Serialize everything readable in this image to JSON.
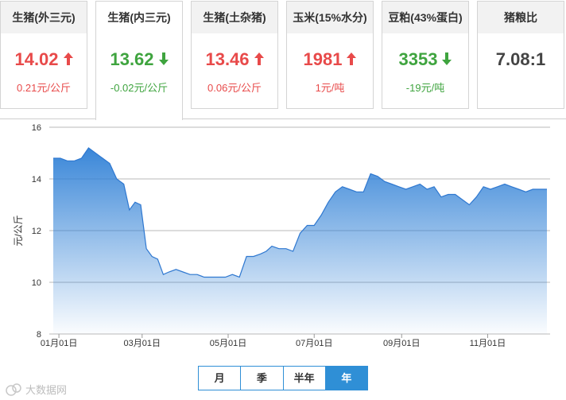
{
  "cards": [
    {
      "title": "生猪(外三元)",
      "price": "14.02",
      "change": "0.21元/公斤",
      "trend": "up"
    },
    {
      "title": "生猪(内三元)",
      "price": "13.62",
      "change": "-0.02元/公斤",
      "trend": "down"
    },
    {
      "title": "生猪(土杂猪)",
      "price": "13.46",
      "change": "0.06元/公斤",
      "trend": "up"
    },
    {
      "title": "玉米(15%水分)",
      "price": "1981",
      "change": "1元/吨",
      "trend": "up"
    },
    {
      "title": "豆粕(43%蛋白)",
      "price": "3353",
      "change": "-19元/吨",
      "trend": "down"
    },
    {
      "title": "猪粮比",
      "price": "7.08:1",
      "change": "",
      "trend": "none"
    }
  ],
  "range_buttons": [
    "月",
    "季",
    "半年",
    "年"
  ],
  "selected_range": "年",
  "watermark": "大数据网",
  "colors": {
    "up": "#e84a4a",
    "down": "#3fa43f",
    "accent": "#2f8fd6"
  },
  "chart_data": {
    "type": "area",
    "title": "",
    "xlabel": "",
    "ylabel": "元/公斤",
    "ylim": [
      8,
      16
    ],
    "yticks": [
      8,
      10,
      12,
      14,
      16
    ],
    "xticks": [
      "01月01日",
      "03月01日",
      "05月01日",
      "07月01日",
      "09月01日",
      "11月01日"
    ],
    "grid": true,
    "legend": "none",
    "x": [
      "12-28",
      "01-02",
      "01-07",
      "01-12",
      "01-17",
      "01-22",
      "01-27",
      "02-01",
      "02-06",
      "02-11",
      "02-16",
      "02-20",
      "02-24",
      "02-28",
      "03-04",
      "03-08",
      "03-12",
      "03-16",
      "03-20",
      "03-25",
      "03-30",
      "04-04",
      "04-09",
      "04-14",
      "04-19",
      "04-24",
      "04-29",
      "05-04",
      "05-09",
      "05-14",
      "05-19",
      "05-24",
      "05-28",
      "06-01",
      "06-06",
      "06-11",
      "06-16",
      "06-21",
      "06-26",
      "07-01",
      "07-06",
      "07-11",
      "07-16",
      "07-21",
      "07-26",
      "07-31",
      "08-05",
      "08-10",
      "08-15",
      "08-20",
      "08-25",
      "08-30",
      "09-04",
      "09-09",
      "09-14",
      "09-19",
      "09-24",
      "09-29",
      "10-04",
      "10-09",
      "10-14",
      "10-19",
      "10-24",
      "10-29",
      "11-03",
      "11-08",
      "11-13",
      "11-18",
      "11-23",
      "11-28",
      "12-03",
      "12-08",
      "12-13"
    ],
    "values": [
      14.8,
      14.8,
      14.7,
      14.7,
      14.8,
      15.2,
      15.0,
      14.8,
      14.6,
      14.0,
      13.8,
      12.8,
      13.1,
      13.0,
      11.3,
      11.0,
      10.9,
      10.3,
      10.4,
      10.5,
      10.4,
      10.3,
      10.3,
      10.2,
      10.2,
      10.2,
      10.2,
      10.3,
      10.2,
      11.0,
      11.0,
      11.1,
      11.2,
      11.4,
      11.3,
      11.3,
      11.2,
      11.9,
      12.2,
      12.2,
      12.6,
      13.1,
      13.5,
      13.7,
      13.6,
      13.5,
      13.5,
      14.2,
      14.1,
      13.9,
      13.8,
      13.7,
      13.6,
      13.7,
      13.8,
      13.6,
      13.7,
      13.3,
      13.4,
      13.4,
      13.2,
      13.0,
      13.3,
      13.7,
      13.6,
      13.7,
      13.8,
      13.7,
      13.6,
      13.5,
      13.6,
      13.6,
      13.6
    ]
  }
}
